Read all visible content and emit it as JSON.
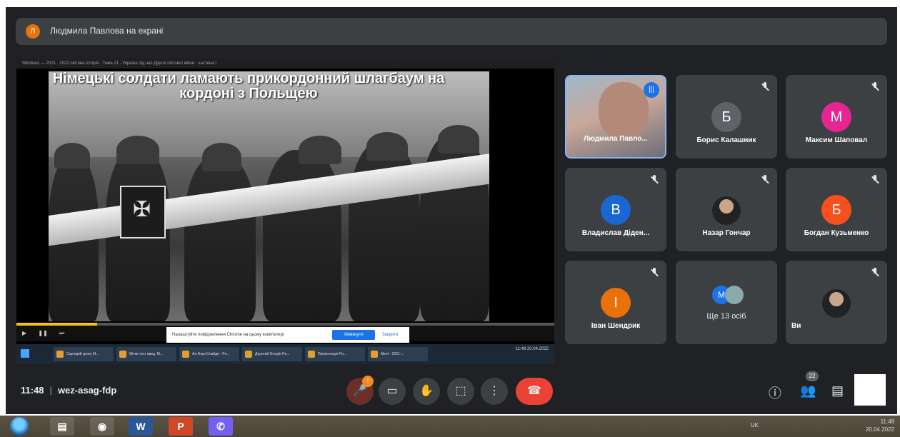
{
  "presenter": {
    "initial": "Л",
    "text": "Людмила Павлова на екрані"
  },
  "shared": {
    "window_title": "Windows — 2021 · 2022 світова історія · Тема 21 · Україна під час Другої світової війни · частина I",
    "caption": "Німецькі солдати ламають прикордонний шлагбаум на кордоні з Польщею",
    "progress": 0.15,
    "notification": "Налаштуйте повідомлення Chrome на цьому комп'ютері",
    "notification_button": "Увімкнути",
    "notification_close": "Закрити",
    "taskbar_items": [
      "Сценарій уроку M...",
      "Мітки тест введ. М...",
      "Ал.Форт.Слайди - Po...",
      "Дорогий Google Pa...",
      "Презентація Po...",
      "Meet - 2021-..."
    ],
    "clock": "11:48 20.04.2022"
  },
  "participants": [
    {
      "name": "Людмила Павло...",
      "type": "video",
      "speaking": true
    },
    {
      "name": "Борис Калашник",
      "initial": "Б",
      "color": "#5f6368"
    },
    {
      "name": "Максим Шаповал",
      "initial": "М",
      "color": "#e52592"
    },
    {
      "name": "Владислав Діден...",
      "initial": "В",
      "color": "#1967d2"
    },
    {
      "name": "Назар Гончар",
      "type": "photo"
    },
    {
      "name": "Богдан Кузьменко",
      "initial": "Б",
      "color": "#f4511e"
    },
    {
      "name": "Іван Шендрик",
      "initial": "І",
      "color": "#e8710a"
    },
    {
      "name": "Ще 13 осіб",
      "initial": "М",
      "color": "#1a73e8",
      "type": "more"
    },
    {
      "name": "Ви",
      "type": "self"
    }
  ],
  "meeting": {
    "time": "11:48",
    "code": "wez-asag-fdp",
    "people_count": "22",
    "mic_badge": "!"
  },
  "windows": {
    "lang": "UK",
    "time": "11:48",
    "date": "20.04.2022"
  }
}
